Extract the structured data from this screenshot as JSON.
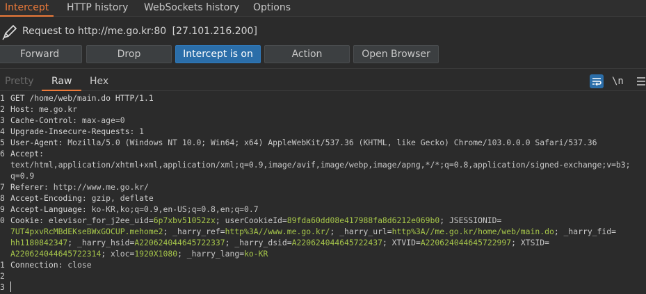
{
  "top_tabs": [
    "Intercept",
    "HTTP history",
    "WebSockets history",
    "Options"
  ],
  "request": {
    "label": "Request to http://me.go.kr:80",
    "ip": "[27.101.216.200]"
  },
  "buttons": {
    "forward": "Forward",
    "drop": "Drop",
    "intercept": "Intercept is on",
    "action": "Action",
    "open_browser": "Open Browser"
  },
  "sub_tabs": [
    "Pretty",
    "Raw",
    "Hex"
  ],
  "toolbar": {
    "newline_label": "\\n"
  },
  "colors": {
    "accent": "#ee7b3a",
    "primary_button": "#2b6ea9",
    "value_green": "#a6c64a"
  },
  "editor": {
    "line_numbers": [
      "1",
      "2",
      "3",
      "4",
      "5",
      "6",
      "",
      "",
      "7",
      "8",
      "9",
      "0",
      "",
      "",
      "",
      "1",
      "2",
      "3"
    ],
    "lines": [
      [
        {
          "t": "GET /home/web/main.do HTTP/1.1",
          "c": "k"
        }
      ],
      [
        {
          "t": "Host",
          "c": "k"
        },
        {
          "t": ": me.go.kr",
          "c": "v"
        }
      ],
      [
        {
          "t": "Cache-Control",
          "c": "k"
        },
        {
          "t": ": max-age=0",
          "c": "v"
        }
      ],
      [
        {
          "t": "Upgrade-Insecure-Requests",
          "c": "k"
        },
        {
          "t": ": 1",
          "c": "v"
        }
      ],
      [
        {
          "t": "User-Agent",
          "c": "k"
        },
        {
          "t": ": Mozilla/5.0 (Windows NT 10.0; Win64; x64) AppleWebKit/537.36 (KHTML, like Gecko) Chrome/103.0.0.0 Safari/537.36",
          "c": "v"
        }
      ],
      [
        {
          "t": "Accept",
          "c": "k"
        },
        {
          "t": ":",
          "c": "v"
        }
      ],
      [
        {
          "t": "text/html,application/xhtml+xml,application/xml;q=0.9,image/avif,image/webp,image/apng,*/*;q=0.8,application/signed-exchange;v=b3;",
          "c": "v"
        }
      ],
      [
        {
          "t": "q=0.9",
          "c": "v"
        }
      ],
      [
        {
          "t": "Referer",
          "c": "k"
        },
        {
          "t": ": http://www.me.go.kr/",
          "c": "v"
        }
      ],
      [
        {
          "t": "Accept-Encoding",
          "c": "k"
        },
        {
          "t": ": gzip, deflate",
          "c": "v"
        }
      ],
      [
        {
          "t": "Accept-Language",
          "c": "k"
        },
        {
          "t": ": ko-KR,ko;q=0.9,en-US;q=0.8,en;q=0.7",
          "c": "v"
        }
      ],
      [
        {
          "t": "Cookie",
          "c": "k"
        },
        {
          "t": ": elevisor_for_j2ee_uid=",
          "c": "v"
        },
        {
          "t": "6p7xbv51052zx",
          "c": "g"
        },
        {
          "t": "; userCookieId=",
          "c": "v"
        },
        {
          "t": "89fda60dd08e417988fa8d6212e069b0",
          "c": "g"
        },
        {
          "t": "; JSESSIONID=",
          "c": "v"
        }
      ],
      [
        {
          "t": "7UT4pxvRcMBdEKseBWxGOCUP.mehome2",
          "c": "g"
        },
        {
          "t": "; _harry_ref=",
          "c": "v"
        },
        {
          "t": "http%3A//www.me.go.kr/",
          "c": "g"
        },
        {
          "t": "; _harry_url=",
          "c": "v"
        },
        {
          "t": "http%3A//me.go.kr/home/web/main.do",
          "c": "g"
        },
        {
          "t": "; _harry_fid=",
          "c": "v"
        }
      ],
      [
        {
          "t": "hh1180842347",
          "c": "g"
        },
        {
          "t": "; _harry_hsid=",
          "c": "v"
        },
        {
          "t": "A220624044645722337",
          "c": "g"
        },
        {
          "t": "; _harry_dsid=",
          "c": "v"
        },
        {
          "t": "A220624044645722437",
          "c": "g"
        },
        {
          "t": "; XTVID=",
          "c": "v"
        },
        {
          "t": "A220624044645722997",
          "c": "g"
        },
        {
          "t": "; XTSID=",
          "c": "v"
        }
      ],
      [
        {
          "t": "A220624044645722314",
          "c": "g"
        },
        {
          "t": "; xloc=",
          "c": "v"
        },
        {
          "t": "1920X1080",
          "c": "g"
        },
        {
          "t": "; _harry_lang=",
          "c": "v"
        },
        {
          "t": "ko-KR",
          "c": "g"
        }
      ],
      [
        {
          "t": "Connection",
          "c": "k"
        },
        {
          "t": ": close",
          "c": "v"
        }
      ],
      [],
      []
    ]
  }
}
